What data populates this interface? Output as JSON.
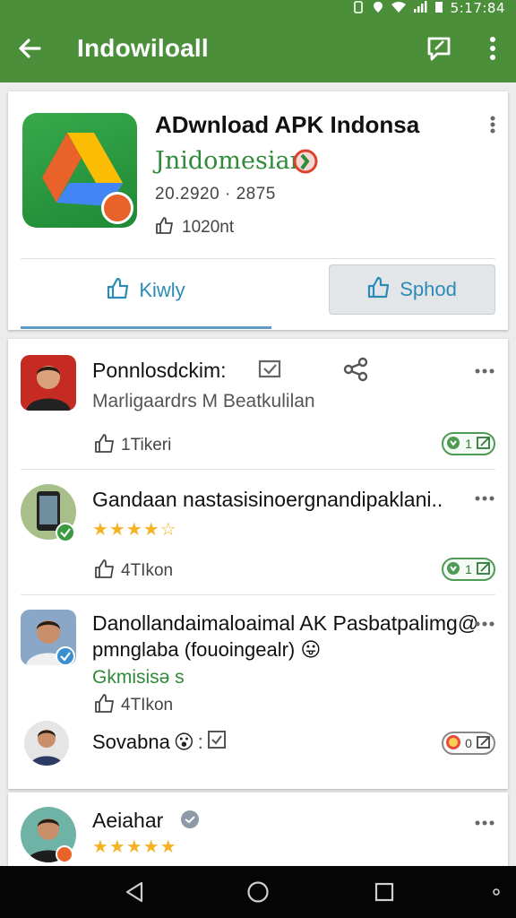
{
  "status_bar": {
    "time": "5:17:84"
  },
  "app_bar": {
    "title": "Indowiloall"
  },
  "app_card": {
    "title": "ADwnload APK Indonsa",
    "subtitle": "Jnidomesian",
    "meta": "20.2920 · 2875",
    "likes": "1020nt",
    "primary_button": "Kiwly",
    "secondary_button": "Sphod"
  },
  "reviews": [
    {
      "name": "Ponnlosdckim:",
      "text": "Marligaardrs M Beatkulilan",
      "likes": "1Tikeri",
      "tag": "1"
    },
    {
      "name": "Gandaan nastasisinoergnandipaklani..",
      "stars": "★★★★☆",
      "likes": "4TIkon",
      "tag": "1"
    },
    {
      "name": "Danollandaimaloaimal AK Pasbatpalimg@",
      "text": "pmnglaba (fouoingealr) 😛",
      "link": "Gkmisisə s",
      "likes": "4TIkon"
    },
    {
      "name": "Sovabna",
      "emoji": "😮",
      "tag": "0"
    }
  ],
  "bottom_review": {
    "name": "Aeiahar",
    "stars": "★★★★★"
  },
  "colors": {
    "primary": "#4b8f3a",
    "accent": "#2b8bb5",
    "star": "#f5b324"
  }
}
